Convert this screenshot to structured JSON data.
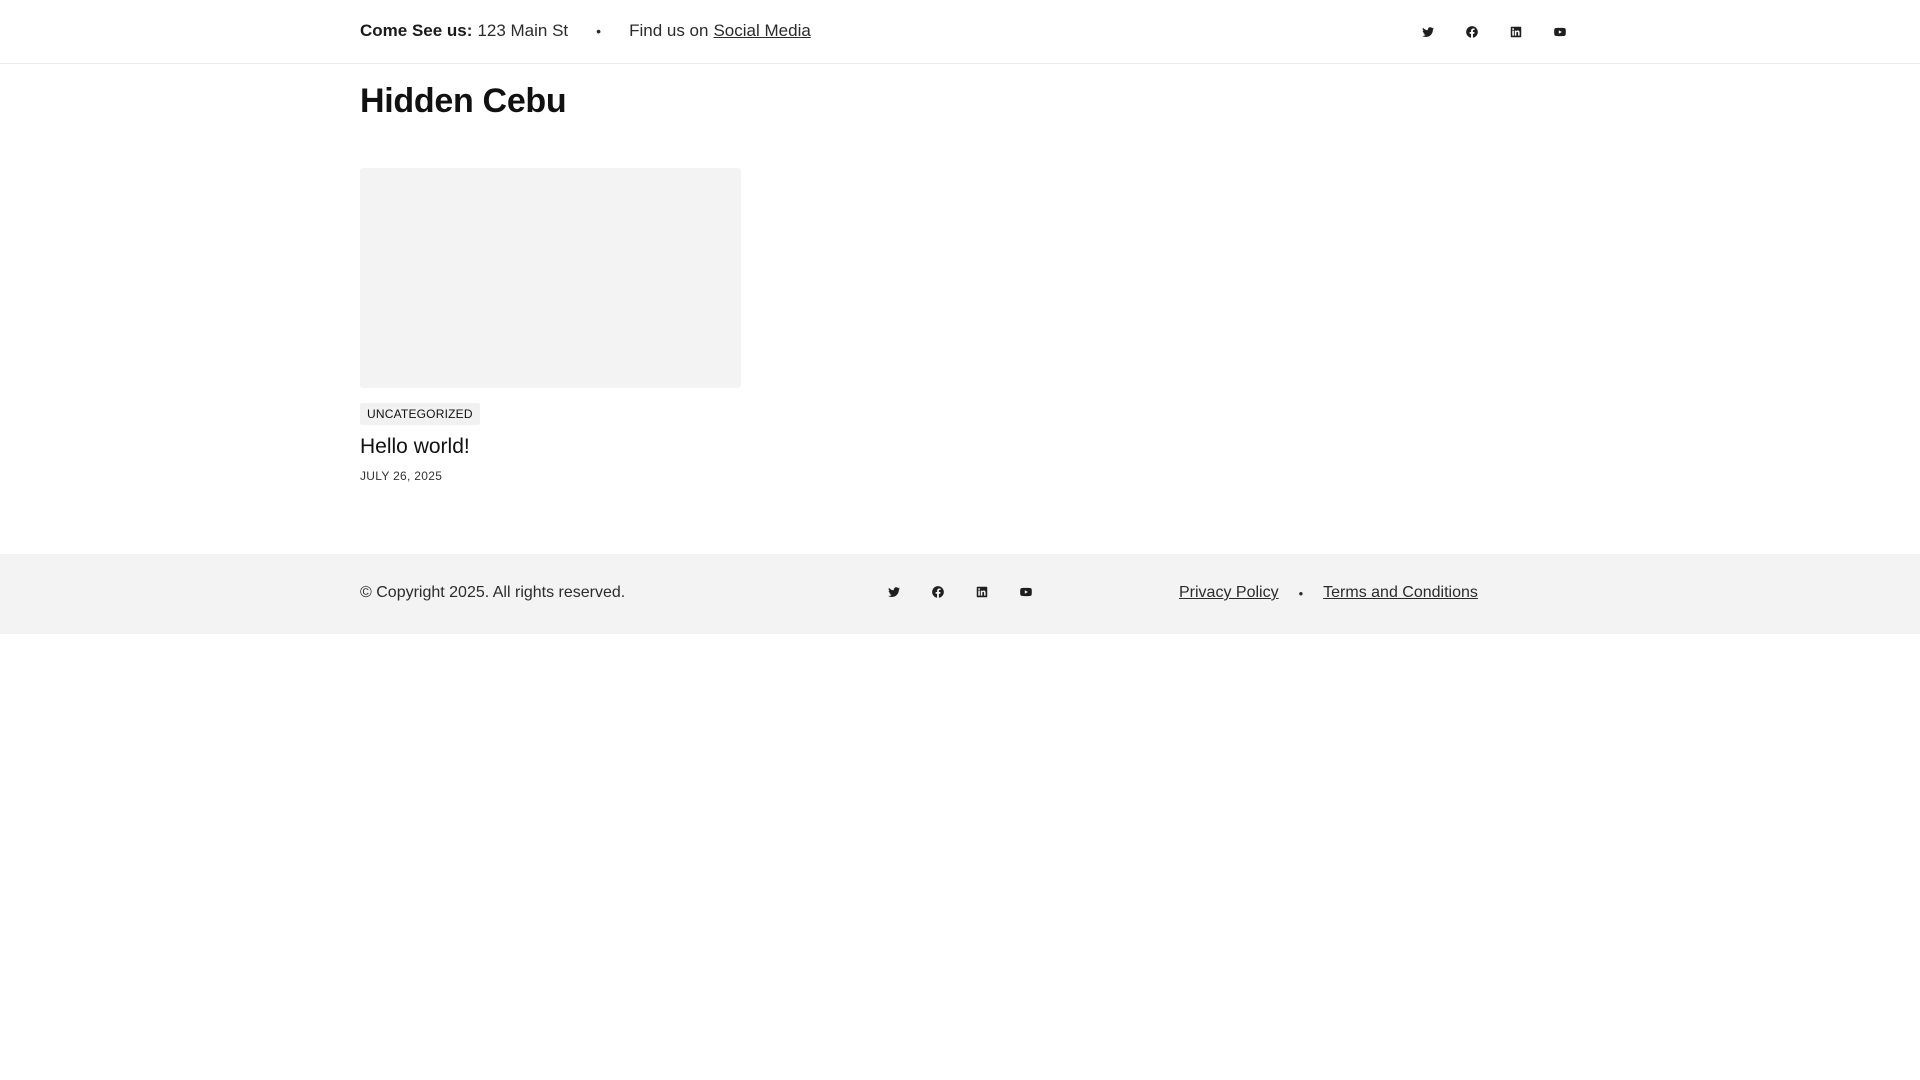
{
  "topbar": {
    "address_label": "Come See us:",
    "address_value": "123 Main St",
    "separator": "•",
    "find_us_text": "Find us on",
    "social_link": "Social Media",
    "social_icons": [
      "twitter-icon",
      "facebook-icon",
      "linkedin-icon",
      "youtube-icon"
    ]
  },
  "site": {
    "title": "Hidden Cebu"
  },
  "posts": [
    {
      "category": "UNCATEGORIZED",
      "title": "Hello world!",
      "date": "JULY 26, 2025"
    }
  ],
  "footer": {
    "copyright": "© Copyright 2025. All rights reserved.",
    "social_icons": [
      "twitter-icon",
      "facebook-icon",
      "linkedin-icon",
      "youtube-icon"
    ],
    "links": [
      "Privacy Policy",
      "Terms and Conditions"
    ],
    "separator": "•"
  },
  "colors": {
    "text": "#1e1e1e",
    "footer_bg": "#f3f3f3",
    "thumb_bg": "#f3f3f3",
    "border": "#ececec"
  }
}
